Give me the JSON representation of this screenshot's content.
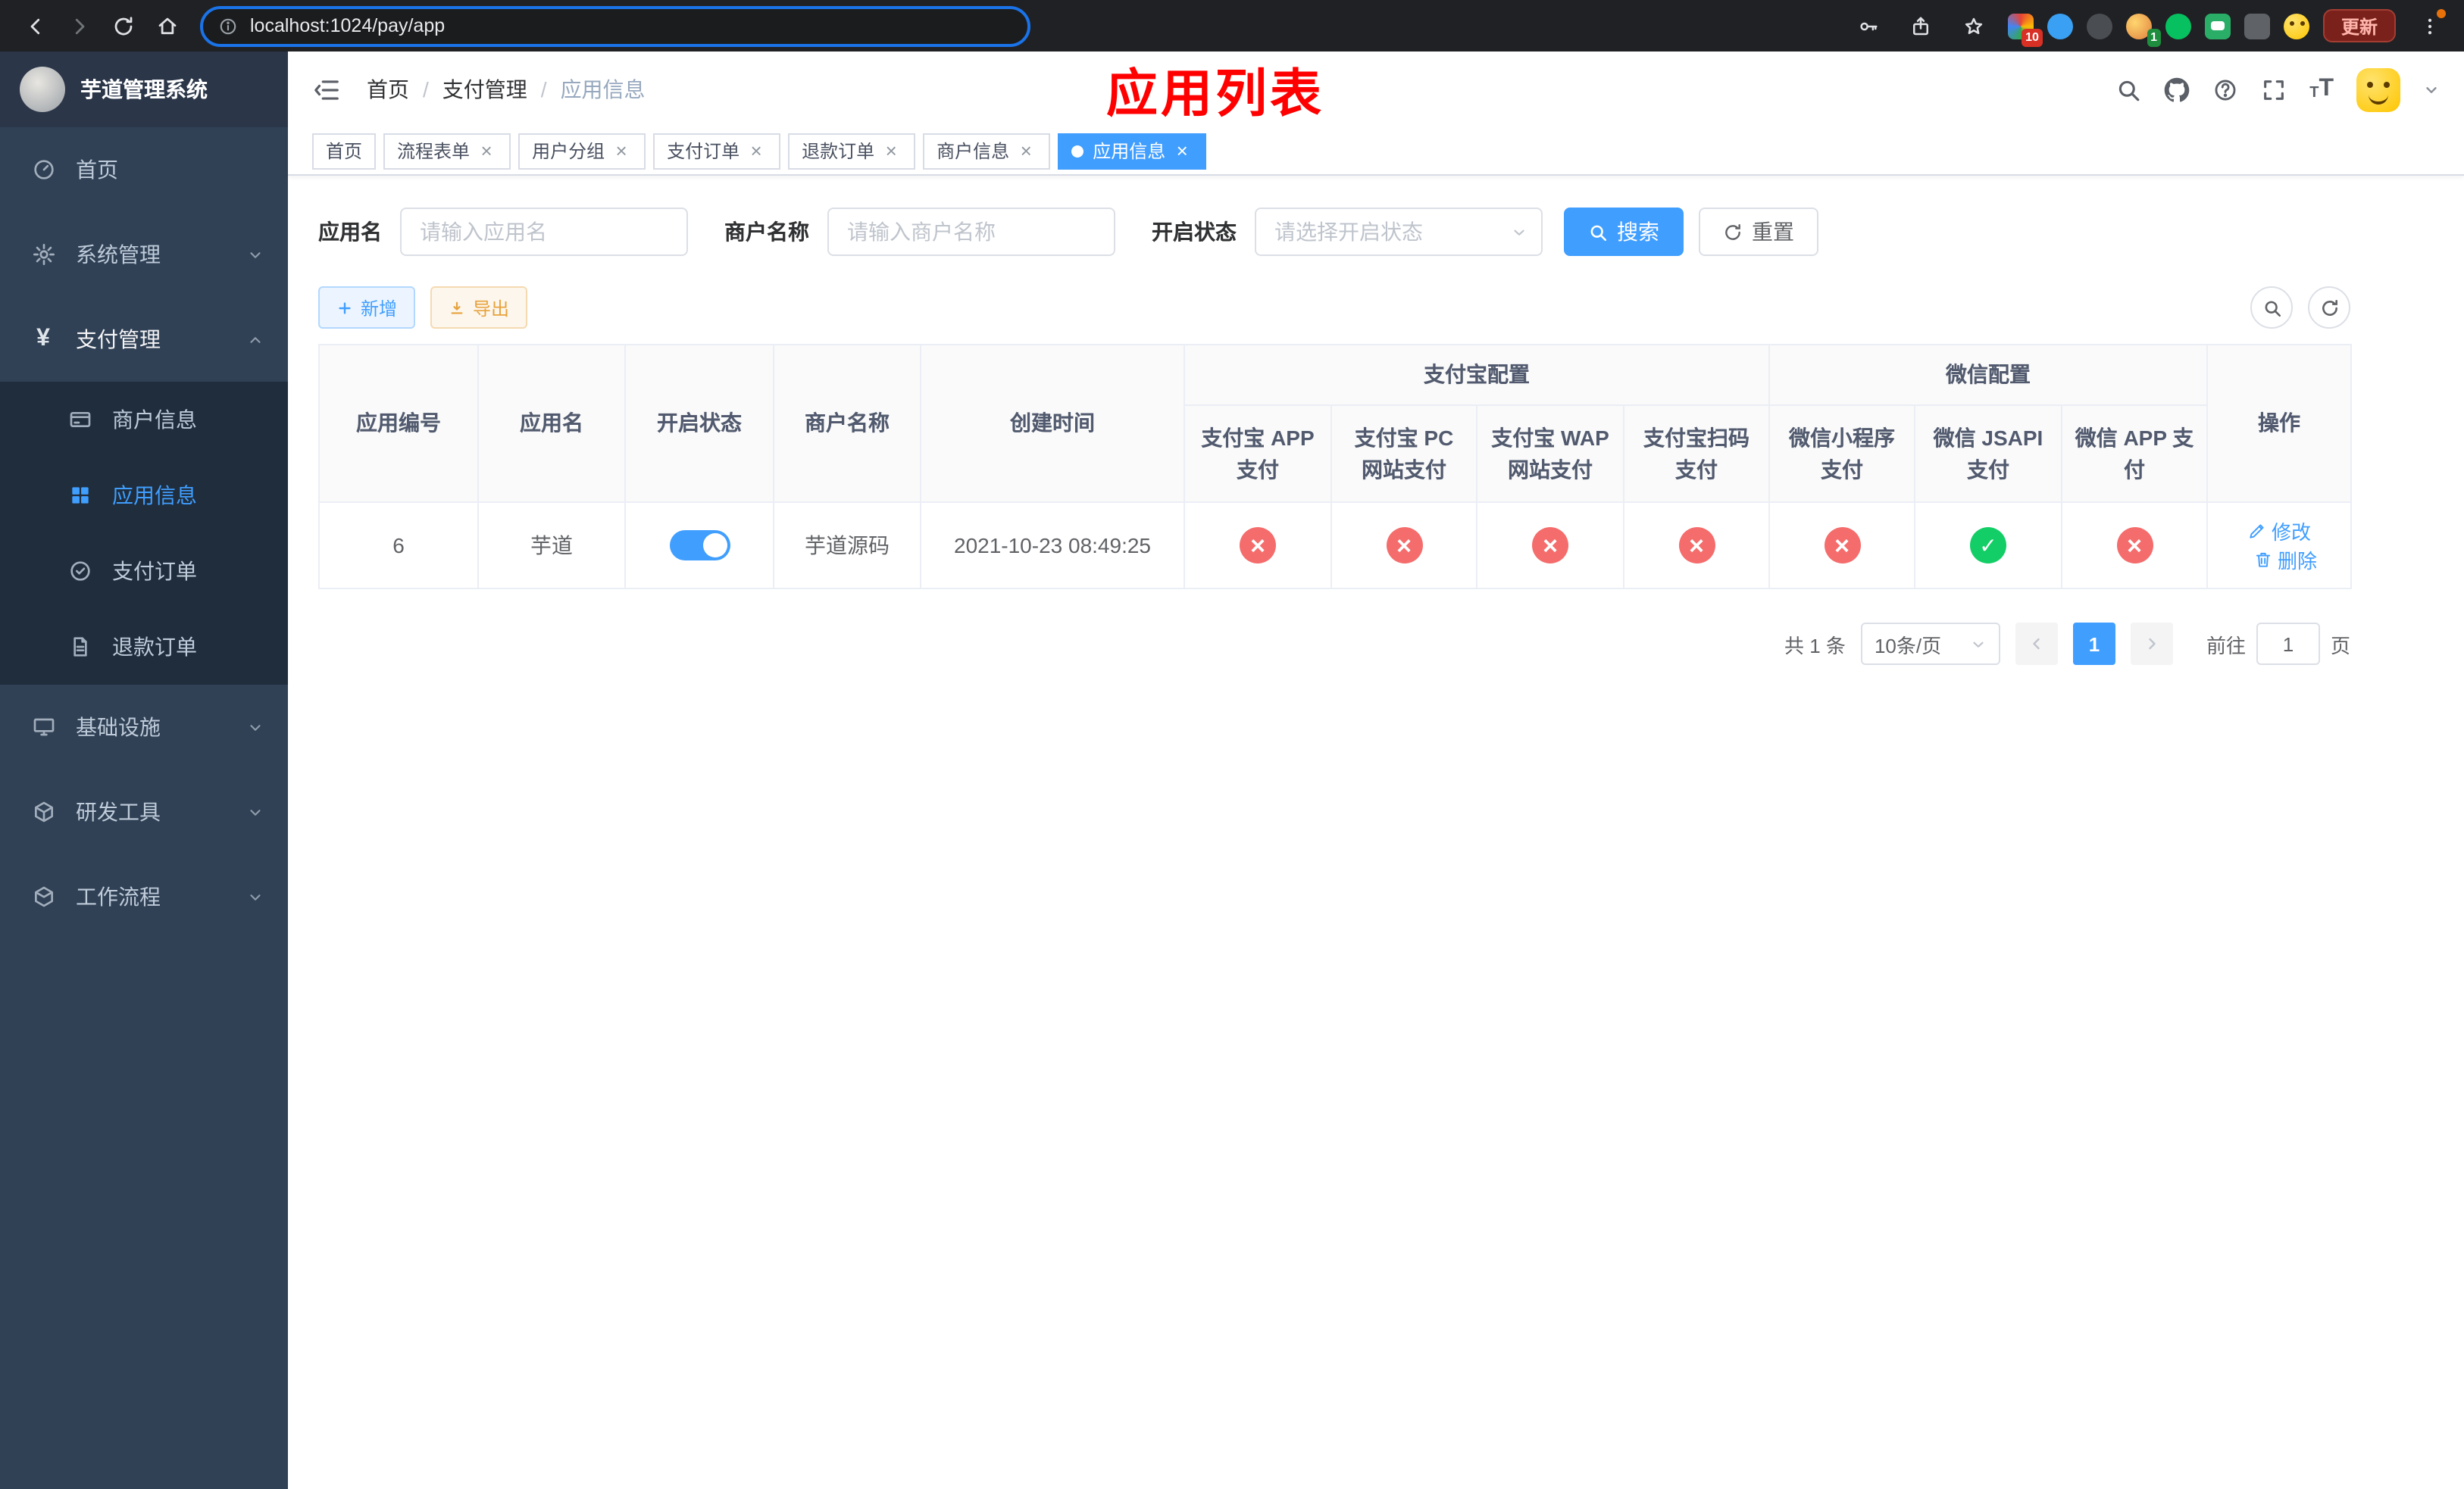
{
  "browser": {
    "url": "localhost:1024/pay/app",
    "update_label": "更新",
    "ext_badge_a": "10",
    "ext_badge_b": "1"
  },
  "sidebar": {
    "app_title": "芋道管理系统",
    "home": "首页",
    "system": "系统管理",
    "payment": "支付管理",
    "merchant_info": "商户信息",
    "app_info": "应用信息",
    "pay_order": "支付订单",
    "refund_order": "退款订单",
    "infra": "基础设施",
    "dev_tools": "研发工具",
    "workflow": "工作流程"
  },
  "header": {
    "crumb_home": "首页",
    "crumb_payment": "支付管理",
    "crumb_current": "应用信息",
    "page_title": "应用列表"
  },
  "tabs": [
    {
      "label": "首页"
    },
    {
      "label": "流程表单"
    },
    {
      "label": "用户分组"
    },
    {
      "label": "支付订单"
    },
    {
      "label": "退款订单"
    },
    {
      "label": "商户信息"
    },
    {
      "label": "应用信息"
    }
  ],
  "filters": {
    "app_name_label": "应用名",
    "app_name_placeholder": "请输入应用名",
    "merchant_label": "商户名称",
    "merchant_placeholder": "请输入商户名称",
    "status_label": "开启状态",
    "status_placeholder": "请选择开启状态",
    "search_label": "搜索",
    "reset_label": "重置"
  },
  "toolbar": {
    "add_label": "新增",
    "export_label": "导出"
  },
  "table": {
    "col_app_id": "应用编号",
    "col_app_name": "应用名",
    "col_status": "开启状态",
    "col_merchant": "商户名称",
    "col_created": "创建时间",
    "group_alipay": "支付宝配置",
    "group_wechat": "微信配置",
    "col_alipay_app": "支付宝 APP 支付",
    "col_alipay_pc": "支付宝 PC 网站支付",
    "col_alipay_wap": "支付宝 WAP 网站支付",
    "col_alipay_qr": "支付宝扫码支付",
    "col_wx_mini": "微信小程序支付",
    "col_wx_jsapi": "微信 JSAPI 支付",
    "col_wx_app": "微信 APP 支付",
    "col_actions": "操作",
    "rows": [
      {
        "app_id": "6",
        "app_name": "芋道",
        "enabled": true,
        "merchant": "芋道源码",
        "created": "2021-10-23 08:49:25",
        "alipay_app": false,
        "alipay_pc": false,
        "alipay_wap": false,
        "alipay_qr": false,
        "wx_mini": false,
        "wx_jsapi": true,
        "wx_app": false,
        "edit_label": "修改",
        "delete_label": "删除"
      }
    ]
  },
  "pagination": {
    "total": "共 1 条",
    "page_size": "10条/页",
    "page": "1",
    "goto_prefix": "前往",
    "goto_value": "1",
    "goto_suffix": "页"
  },
  "colors": {
    "primary": "#409eff",
    "danger": "#f56c6c",
    "success": "#13ce66",
    "warning": "#e6a23c",
    "title_red": "#ff0000",
    "sidebar_bg": "#304156",
    "submenu_bg": "#1f2d3d"
  }
}
